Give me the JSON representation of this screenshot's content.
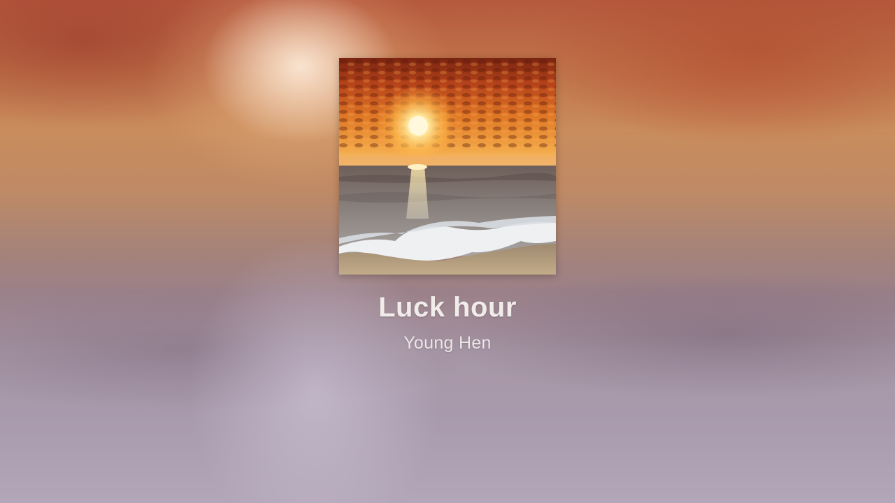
{
  "track": {
    "title": "Luck hour",
    "artist": "Young Hen"
  },
  "cover_art": {
    "subject": "sunset over ocean shoreline",
    "icon": "album-cover-image"
  },
  "colors": {
    "title_text": "#f1ecea",
    "artist_text": "#ece6e6",
    "sky_top": "#b6593e",
    "sky_sun": "#ffe6a0",
    "sea": "#8a8688",
    "sand": "#b49c7c"
  }
}
